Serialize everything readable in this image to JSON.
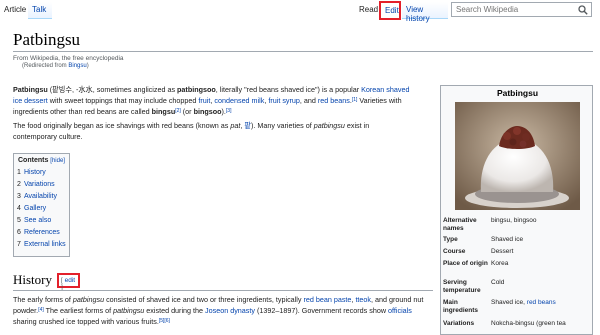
{
  "tabs": {
    "article": "Article",
    "talk": "Talk",
    "read": "Read",
    "edit": "Edit",
    "history": "View history"
  },
  "search": {
    "placeholder": "Search Wikipedia"
  },
  "page": {
    "title": "Patbingsu",
    "from": "From Wikipedia, the free encyclopedia",
    "redirected_prefix": "(Redirected from ",
    "redirected_link": "Bingsu",
    "redirected_suffix": ")"
  },
  "intro": {
    "p1": {
      "bold1": "Patbingsu",
      "t1": " (팥빙수, -水水, sometimes anglicized as ",
      "bold2": "patbingsoo",
      "t2": ", literally \"red beans shaved ice\") is a popular ",
      "link1": "Korean shaved ice dessert",
      "t3": " with sweet toppings that may include chopped ",
      "link2": "fruit",
      "t4": ", ",
      "link3": "condensed milk",
      "t5": ", ",
      "link4": "fruit syrup",
      "t6": ", and ",
      "link5": "red beans",
      "t7": ".",
      "ref1": "[1]",
      "t8": " Varieties with ingredients other than red beans are called ",
      "bold3": "bingsu",
      "ref2": "[2]",
      "t9": " (or ",
      "bold4": "bingsoo",
      "t10": ").",
      "ref3": "[3]"
    },
    "p2": {
      "t1": "The food originally began as ice shavings with red beans (known as ",
      "italic1": "pat",
      "t2": ", ",
      "link1": "팥",
      "t3": "). Many varieties of ",
      "italic2": "patbingsu",
      "t4": " exist in contemporary culture."
    }
  },
  "toc": {
    "title": "Contents",
    "hide": "[hide]",
    "items": [
      {
        "num": "1",
        "label": "History"
      },
      {
        "num": "2",
        "label": "Variations"
      },
      {
        "num": "3",
        "label": "Availability"
      },
      {
        "num": "4",
        "label": "Gallery"
      },
      {
        "num": "5",
        "label": "See also"
      },
      {
        "num": "6",
        "label": "References"
      },
      {
        "num": "7",
        "label": "External links"
      }
    ]
  },
  "history": {
    "heading": "History",
    "edit_open": "[ ",
    "edit": "edit",
    "edit_close": " ]",
    "t1": "The early forms of ",
    "italic1": "patbingsu",
    "t2": " consisted of shaved ice and two or three ingredients, typically ",
    "link1": "red bean paste",
    "t3": ", ",
    "link2": "tteok",
    "t4": ", and ground nut powder.",
    "ref1": "[4]",
    "t5": " The earliest forms of ",
    "italic2": "patbingsu",
    "t6": " existed during the ",
    "link3": "Joseon dynasty",
    "t7": " (1392–1897). Government records show ",
    "link4": "officials",
    "t8": " sharing crushed ice topped with various fruits.",
    "ref2": "[5][6]"
  },
  "infobox": {
    "title": "Patbingsu",
    "rows": [
      {
        "label": "Alternative names",
        "value": "bingsu, bingsoo"
      },
      {
        "label": "Type",
        "value": "Shaved ice",
        "link": true
      },
      {
        "label": "Course",
        "value": "Dessert",
        "link": true
      },
      {
        "label": "Place of origin",
        "value": "Korea",
        "link": true
      },
      {
        "label": "Serving temperature",
        "value": "Cold"
      },
      {
        "label": "Main ingredients",
        "value_plain": "Shaved ice, ",
        "value_link": "red beans"
      },
      {
        "label": "Variations",
        "value": "Nokcha-bingsu (green tea"
      }
    ]
  },
  "colors": {
    "link": "#0645ad",
    "highlight_border": "#e3202b"
  }
}
